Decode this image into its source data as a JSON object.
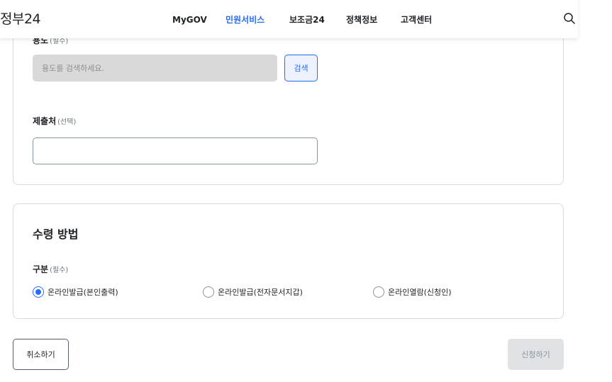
{
  "header": {
    "logo": "정부24",
    "nav": [
      {
        "label": "MyGOV",
        "active": false
      },
      {
        "label": "민원서비스",
        "active": true
      },
      {
        "label": "보조금24",
        "active": false
      },
      {
        "label": "정책정보",
        "active": false
      },
      {
        "label": "고객센터",
        "active": false
      }
    ],
    "search_icon": "search-icon"
  },
  "purpose": {
    "label": "용도",
    "sub": "(필수)",
    "placeholder": "용도를 검색하세요.",
    "value": "",
    "search_button": "검색"
  },
  "submit_to": {
    "label": "제출처",
    "sub": "(선택)",
    "value": ""
  },
  "receive_method": {
    "title": "수령 방법",
    "category_label": "구분",
    "category_sub": "(필수)",
    "options": [
      {
        "label": "온라인발급(본인출력)",
        "checked": true
      },
      {
        "label": "온라인발급(전자문서지갑)",
        "checked": false
      },
      {
        "label": "온라인열람(신청인)",
        "checked": false
      }
    ]
  },
  "actions": {
    "cancel": "취소하기",
    "apply": "신청하기"
  },
  "colors": {
    "accent": "#256ef4",
    "border": "#d7dbe0",
    "disabled_bg": "#e0e2e5",
    "input_disabled_bg": "#d9d9d9"
  }
}
